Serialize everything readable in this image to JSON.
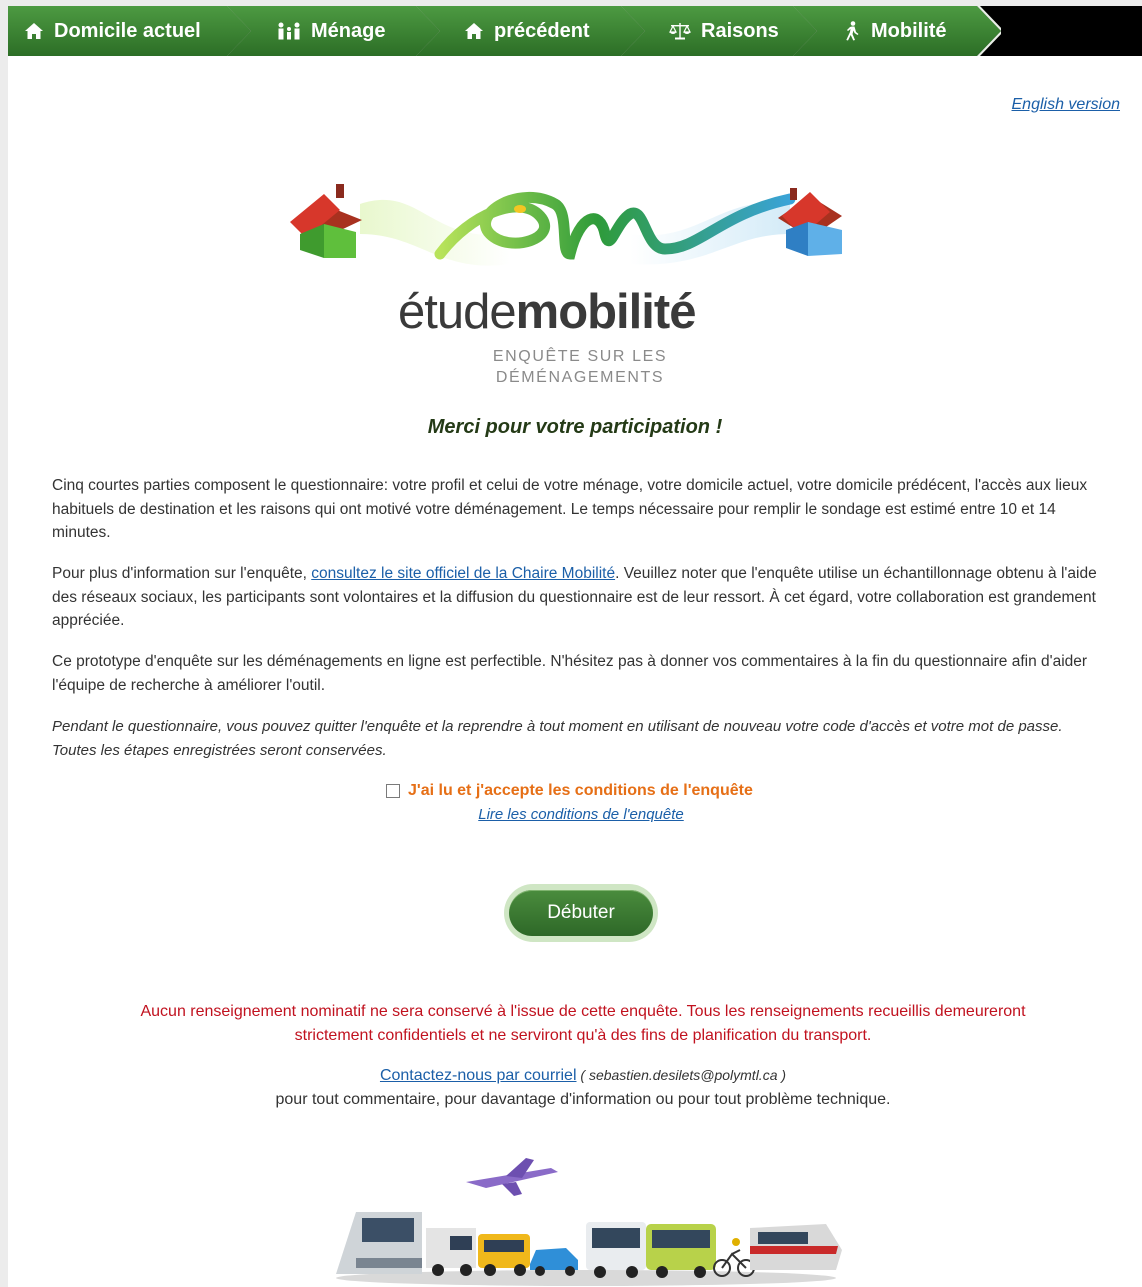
{
  "nav": {
    "steps": [
      {
        "label": "Domicile actuel",
        "icon": "home-icon"
      },
      {
        "label": "Ménage",
        "icon": "household-icon"
      },
      {
        "label": "précédent",
        "icon": "home-icon"
      },
      {
        "label": "Raisons",
        "icon": "scale-icon"
      },
      {
        "label": "Mobilité",
        "icon": "walking-icon"
      }
    ],
    "active_color": "#3d8a35"
  },
  "english_link": "English version",
  "logo": {
    "word_light": "étude",
    "word_bold": "mobilité",
    "subtitle_line1": "ENQUÊTE SUR LES",
    "subtitle_line2": "DÉMÉNAGEMENTS"
  },
  "thanks": "Merci pour votre participation !",
  "intro": {
    "p1": "Cinq courtes parties composent le questionnaire: votre profil et celui de votre ménage, votre domicile actuel, votre domicile prédécent, l'accès aux lieux habituels de destination et les raisons qui ont motivé votre déménagement. Le temps nécessaire pour remplir le sondage est estimé entre 10 et 14 minutes.",
    "p2_before": "Pour plus d'information sur l'enquête, ",
    "p2_link": "consultez le site officiel de la Chaire Mobilité",
    "p2_after": ". Veuillez noter que l'enquête utilise un échantillonnage obtenu à l'aide des réseaux sociaux, les participants sont volontaires et la diffusion du questionnaire est de leur ressort. À cet égard, votre collaboration est grandement appréciée.",
    "p3": "Ce prototype d'enquête sur les déménagements en ligne est perfectible. N'hésitez pas à donner vos commentaires à la fin du questionnaire afin d'aider l'équipe de recherche à améliorer l'outil.",
    "p4": "Pendant le questionnaire, vous pouvez quitter l'enquête et la reprendre à tout moment en utilisant de nouveau votre code d'accès et votre mot de passe. Toutes les étapes enregistrées seront conservées."
  },
  "accept": {
    "checked": false,
    "label": "J'ai lu et j'accepte les conditions de l'enquête",
    "link": "Lire les conditions de l'enquête",
    "color": "#e66f16"
  },
  "start_button": "Débuter",
  "warning": {
    "line1": "Aucun renseignement nominatif ne sera conservé à l'issue de cette enquête. Tous les renseignements recueillis demeureront",
    "line2": "strictement confidentiels et ne serviront qu'à des fins de planification du transport.",
    "color": "#c1121f"
  },
  "contact": {
    "link": "Contactez-nous par courriel",
    "email_open": " ( ",
    "email": "sebastien.desilets@polymtl.ca",
    "email_close": " )",
    "line2": "pour tout commentaire, pour davantage d'information ou pour tout problème technique."
  }
}
